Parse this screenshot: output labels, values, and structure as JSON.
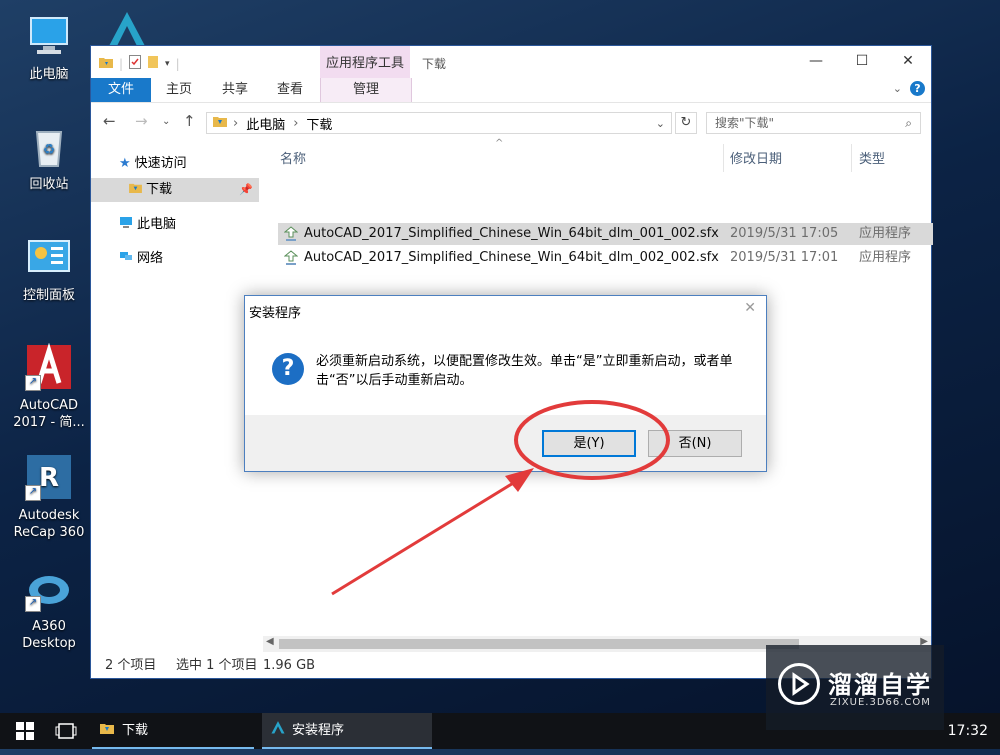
{
  "desktop": {
    "icons": [
      {
        "label": "此电脑",
        "icon": "computer-icon"
      },
      {
        "label": "回收站",
        "icon": "recycle-bin-icon"
      },
      {
        "label": "控制面板",
        "icon": "control-panel-icon"
      },
      {
        "label": "AutoCAD\n2017 - 简...",
        "icon": "autocad-icon"
      },
      {
        "label": "Autodesk\nReCap 360",
        "icon": "recap-icon"
      },
      {
        "label": "A360\nDesktop",
        "icon": "a360-icon"
      }
    ]
  },
  "explorer": {
    "context_tab": "应用程序工具",
    "title": "下载",
    "ribbon_tabs": [
      "文件",
      "主页",
      "共享",
      "查看",
      "管理"
    ],
    "address_path": [
      "此电脑",
      "下载"
    ],
    "search_placeholder": "搜索\"下载\"",
    "nav": [
      {
        "label": "快速访问",
        "icon": "star-icon"
      },
      {
        "label": "下载",
        "icon": "download-folder-icon"
      },
      {
        "label": "此电脑",
        "icon": "computer-icon"
      },
      {
        "label": "网络",
        "icon": "network-icon"
      }
    ],
    "columns": {
      "name": "名称",
      "date": "修改日期",
      "type": "类型"
    },
    "files": [
      {
        "name": "AutoCAD_2017_Simplified_Chinese_Win_64bit_dlm_001_002.sfx",
        "date": "2019/5/31 17:05",
        "type": "应用程序",
        "selected": true
      },
      {
        "name": "AutoCAD_2017_Simplified_Chinese_Win_64bit_dlm_002_002.sfx",
        "date": "2019/5/31 17:01",
        "type": "应用程序",
        "selected": false
      }
    ],
    "status": {
      "count": "2 个项目",
      "selected": "选中 1 个项目",
      "size": "1.96 GB"
    }
  },
  "dialog": {
    "title": "安装程序",
    "message": "必须重新启动系统，以便配置修改生效。单击“是”立即重新启动，或者单击“否”以后手动重新启动。",
    "yes": "是(Y)",
    "no": "否(N)"
  },
  "taskbar": {
    "tasks": [
      "下载",
      "安装程序"
    ],
    "clock": "17:32"
  },
  "watermark": {
    "title": "溜溜自学",
    "url": "ZIXUE.3D66.COM"
  },
  "colors": {
    "accent": "#1979ca",
    "annotation": "#e23b3b",
    "context_tab": "#f2dcf0"
  }
}
